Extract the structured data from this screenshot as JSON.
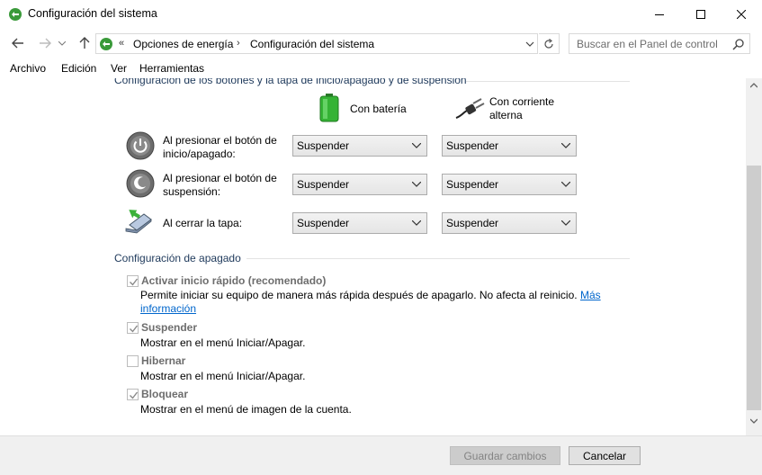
{
  "window": {
    "title": "Configuración del sistema",
    "icon": "power-options-icon"
  },
  "nav": {
    "breadcrumb": [
      "Opciones de energía",
      "Configuración del sistema"
    ],
    "breadcrumb_prefix": "«",
    "breadcrumb_sep": "›",
    "search_placeholder": "Buscar en el Panel de control"
  },
  "menu": {
    "items": [
      "Archivo",
      "Edición",
      "Ver",
      "Herramientas"
    ]
  },
  "buttons_section": {
    "title": "Configuración de los botones y la tapa de inicio/apagado y de suspensión",
    "columns": [
      "Con batería",
      "Con corriente alterna"
    ],
    "rows": [
      {
        "label": "Al presionar el botón de inicio/apagado:",
        "battery": "Suspender",
        "ac": "Suspender",
        "icon": "power-button-icon"
      },
      {
        "label": "Al presionar el botón de suspensión:",
        "battery": "Suspender",
        "ac": "Suspender",
        "icon": "sleep-button-icon"
      },
      {
        "label": "Al cerrar la tapa:",
        "battery": "Suspender",
        "ac": "Suspender",
        "icon": "laptop-lid-icon"
      }
    ]
  },
  "shutdown_section": {
    "title": "Configuración de apagado",
    "options": [
      {
        "title": "Activar inicio rápido (recomendado)",
        "checked": true,
        "desc": "Permite iniciar su equipo de manera más rápida después de apagarlo. No afecta al reinicio.",
        "link": "Más información"
      },
      {
        "title": "Suspender",
        "checked": true,
        "desc": "Mostrar en el menú Iniciar/Apagar."
      },
      {
        "title": "Hibernar",
        "checked": false,
        "desc": "Mostrar en el menú Iniciar/Apagar."
      },
      {
        "title": "Bloquear",
        "checked": true,
        "desc": "Mostrar en el menú de imagen de la cuenta."
      }
    ]
  },
  "footer": {
    "save_label": "Guardar cambios",
    "cancel_label": "Cancelar"
  },
  "colors": {
    "section_title": "#1e395b",
    "link": "#0066cc",
    "disabled_text": "#6d6d6d"
  }
}
